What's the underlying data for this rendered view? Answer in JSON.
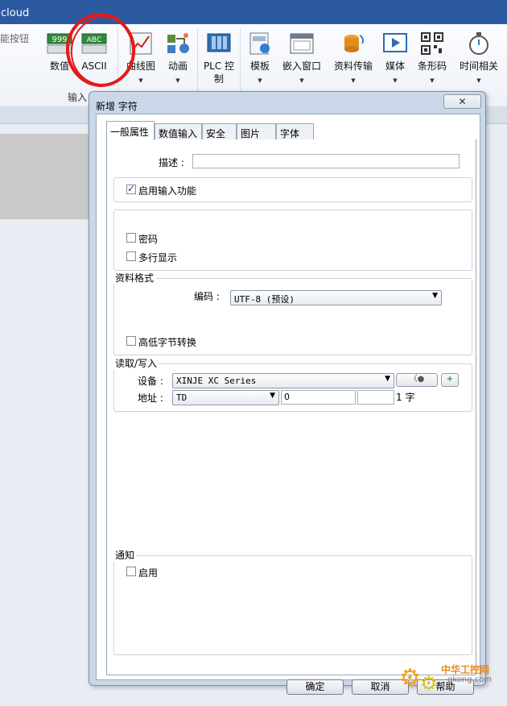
{
  "titlebar": {
    "text": "cloud"
  },
  "ribbon": {
    "left_cut_label": "能按钮",
    "buttons": [
      {
        "label": "数值"
      },
      {
        "label": "ASCII"
      },
      {
        "label": "曲线图"
      },
      {
        "label": "动画"
      },
      {
        "label": "PLC 控\n制"
      },
      {
        "label": "模板"
      },
      {
        "label": "嵌入窗口"
      },
      {
        "label": "资料传输"
      },
      {
        "label": "媒体"
      },
      {
        "label": "条形码"
      },
      {
        "label": "时间相关"
      }
    ],
    "group_label": "输入",
    "icon_text_numeric": "999",
    "icon_text_ascii": "ABC"
  },
  "dialog": {
    "title": "新增 字符",
    "close_label": "✕",
    "tabs": [
      "一般属性",
      "数值输入",
      "安全",
      "图片",
      "字体"
    ],
    "description_label": "描述 :",
    "description_value": "",
    "enable_input_label": "启用输入功能",
    "password_label": "密码",
    "multiline_label": "多行显示",
    "data_format_legend": "资料格式",
    "encoding_label": "编码 :",
    "encoding_value": "UTF-8 (预设)",
    "byte_swap_label": "高低字节转换",
    "read_write_legend": "读取/写入",
    "device_label": "设备 :",
    "device_value": "XINJE XC Series",
    "address_label": "地址 :",
    "address_type": "TD",
    "address_value": "0",
    "address_extra": "",
    "word_count": "1 字",
    "notify_legend": "通知",
    "notify_enable_label": "启用",
    "ok_label": "确定",
    "cancel_label": "取消",
    "help_label": "帮助"
  },
  "watermark": {
    "line1": "中华工控网",
    "line2": "gkong.com"
  }
}
